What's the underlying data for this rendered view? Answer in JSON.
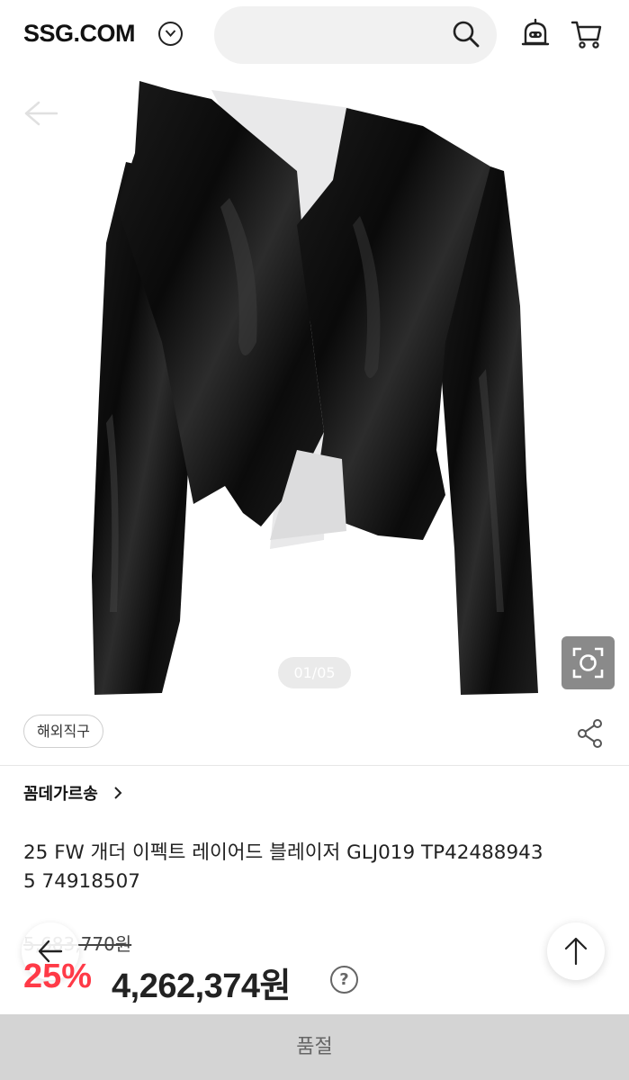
{
  "header": {
    "logo": "SSG.COM",
    "search_placeholder": ""
  },
  "gallery": {
    "indicator": "01/05"
  },
  "badges": {
    "overseas": "해외직구"
  },
  "product": {
    "brand": "꼼데가르송",
    "title_line1": "25 FW 개더 이펙트 레이어드 블레이저 GLJ019 TP42488943",
    "title_line2": "5 74918507",
    "original_price": "5,683,770원",
    "discount": "25%",
    "sale_price": "4,262,374원",
    "help": "?"
  },
  "footer": {
    "soldout_label": "품절"
  },
  "colors": {
    "discount": "#ff3a47",
    "soldout_bg": "#d4d4d4"
  },
  "icons": [
    "chevron-down-icon",
    "search-icon",
    "bell-icon",
    "cart-icon",
    "back-arrow-icon",
    "camera-lens-icon",
    "share-icon",
    "chevron-right-icon",
    "arrow-up-icon",
    "question-icon"
  ]
}
